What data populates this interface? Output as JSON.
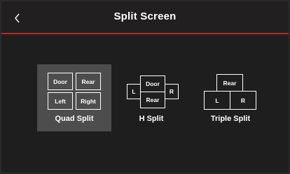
{
  "header": {
    "title": "Split Screen",
    "back_icon": "chevron-left-icon",
    "accent_color": "#b32a22"
  },
  "options": [
    {
      "label": "Quad Split",
      "selected": true,
      "cells": [
        "Door",
        "Rear",
        "Left",
        "Right"
      ]
    },
    {
      "label": "H Split",
      "selected": false,
      "cells": [
        "L",
        "Door",
        "Rear",
        "R"
      ]
    },
    {
      "label": "Triple Split",
      "selected": false,
      "cells": [
        "Rear",
        "L",
        "R"
      ]
    }
  ]
}
